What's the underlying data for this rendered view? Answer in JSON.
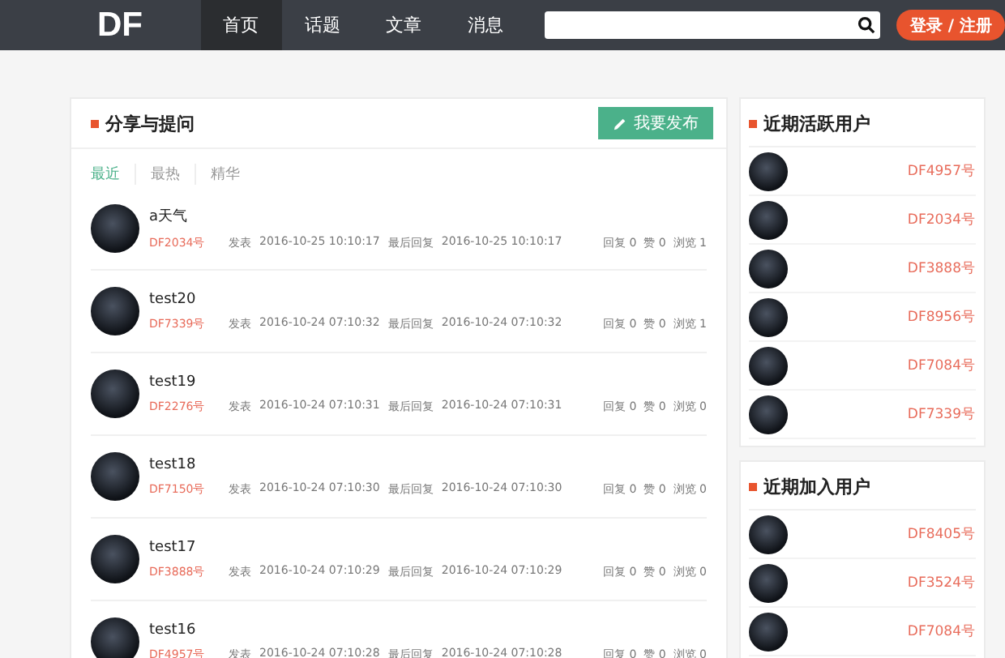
{
  "nav": {
    "logo": "DF",
    "items": [
      {
        "label": "首页",
        "selected": true
      },
      {
        "label": "话题",
        "selected": false
      },
      {
        "label": "文章",
        "selected": false
      },
      {
        "label": "消息",
        "selected": false
      }
    ],
    "login": "登录 / 注册"
  },
  "main": {
    "title": "分享与提问",
    "post_button": "我要发布",
    "tabs": [
      {
        "label": "最近",
        "selected": true
      },
      {
        "label": "最热",
        "selected": false
      },
      {
        "label": "精华",
        "selected": false
      }
    ],
    "posts": [
      {
        "title": "a天气",
        "user": "DF2034号",
        "posted_label": "发表",
        "posted": "2016-10-25 10:10:17",
        "last_label": "最后回复",
        "last": "2016-10-25 10:10:17",
        "stats": "回复 0  赞 0  浏览 1"
      },
      {
        "title": "test20",
        "user": "DF7339号",
        "posted_label": "发表",
        "posted": "2016-10-24 07:10:32",
        "last_label": "最后回复",
        "last": "2016-10-24 07:10:32",
        "stats": "回复 0  赞 0  浏览 1"
      },
      {
        "title": "test19",
        "user": "DF2276号",
        "posted_label": "发表",
        "posted": "2016-10-24 07:10:31",
        "last_label": "最后回复",
        "last": "2016-10-24 07:10:31",
        "stats": "回复 0  赞 0  浏览 0"
      },
      {
        "title": "test18",
        "user": "DF7150号",
        "posted_label": "发表",
        "posted": "2016-10-24 07:10:30",
        "last_label": "最后回复",
        "last": "2016-10-24 07:10:30",
        "stats": "回复 0  赞 0  浏览 0"
      },
      {
        "title": "test17",
        "user": "DF3888号",
        "posted_label": "发表",
        "posted": "2016-10-24 07:10:29",
        "last_label": "最后回复",
        "last": "2016-10-24 07:10:29",
        "stats": "回复 0  赞 0  浏览 0"
      },
      {
        "title": "test16",
        "user": "DF4957号",
        "posted_label": "发表",
        "posted": "2016-10-24 07:10:28",
        "last_label": "最后回复",
        "last": "2016-10-24 07:10:28",
        "stats": "回复 0  赞 0  浏览 0"
      }
    ]
  },
  "sidebar": [
    {
      "title": "近期活跃用户",
      "users": [
        "DF4957号",
        "DF2034号",
        "DF3888号",
        "DF8956号",
        "DF7084号",
        "DF7339号"
      ]
    },
    {
      "title": "近期加入用户",
      "users": [
        "DF8405号",
        "DF3524号",
        "DF7084号"
      ]
    }
  ]
}
